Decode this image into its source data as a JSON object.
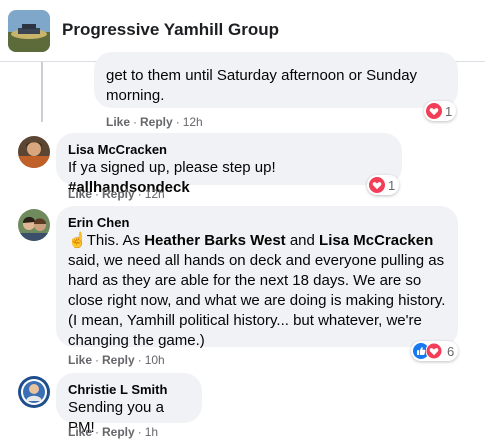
{
  "header": {
    "group_name": "Progressive Yamhill Group"
  },
  "comments": [
    {
      "text": "get to them until Saturday afternoon or Sunday morning.",
      "reaction_count": "1",
      "like": "Like",
      "reply": "Reply",
      "time": "12h"
    },
    {
      "author": "Lisa McCracken",
      "text_before": "If ya signed up, please step up! ",
      "text_bold": "#allhandsondeck",
      "reaction_count": "1",
      "like": "Like",
      "reply": "Reply",
      "time": "12h"
    },
    {
      "author": "Erin Chen",
      "emoji": "☝",
      "text_1": "This. As ",
      "mention_1": "Heather Barks West",
      "text_2": " and ",
      "mention_2": "Lisa McCracken",
      "text_3": " said, we need all hands on deck and everyone pulling as hard as they are able for the next 18 days. We are so close right now, and what we are doing is making history. (I mean, Yamhill political history... but whatever, we're changing the game.)",
      "reaction_count": "6",
      "like": "Like",
      "reply": "Reply",
      "time": "10h"
    },
    {
      "author": "Christie L Smith",
      "text": "Sending you a PM!",
      "like": "Like",
      "reply": "Reply",
      "time": "1h"
    }
  ],
  "colors": {
    "love": "#f33e58",
    "like": "#1877f2",
    "bubble": "#f0f2f5",
    "meta": "#65676b"
  },
  "icons": [
    "group-photo",
    "heart-reaction",
    "like-reaction",
    "avatar"
  ]
}
